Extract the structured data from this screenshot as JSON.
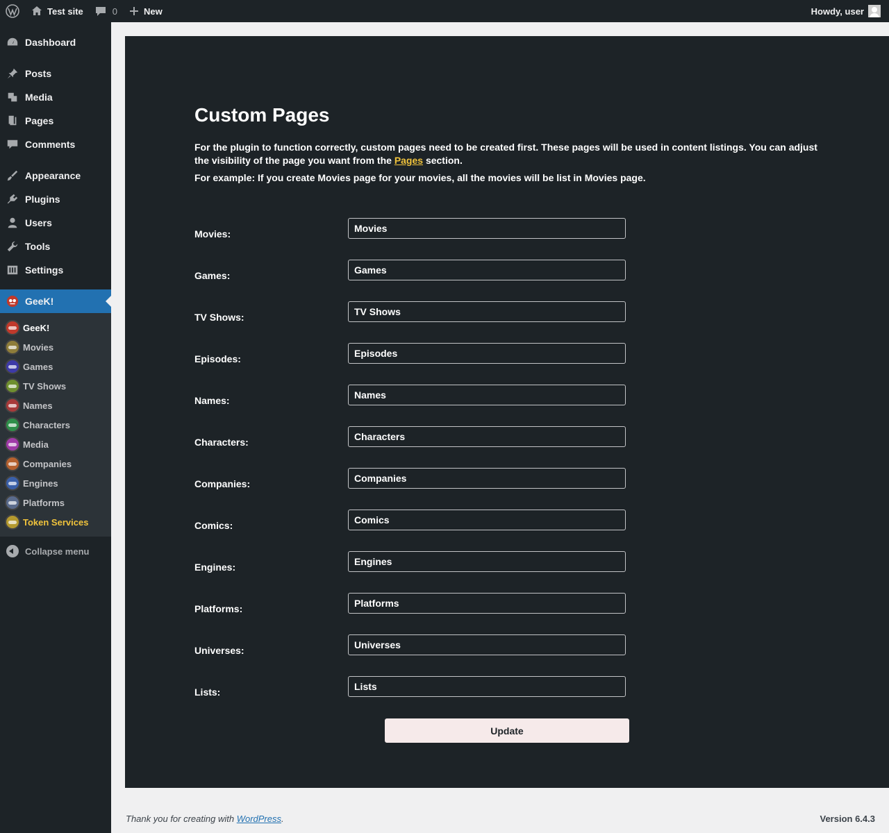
{
  "adminbar": {
    "site_name": "Test site",
    "comments_count": "0",
    "new_label": "New",
    "howdy": "Howdy, user"
  },
  "sidebar": {
    "items": [
      {
        "label": "Dashboard",
        "icon": "dashboard-icon"
      },
      {
        "label": "Posts",
        "icon": "pin-icon"
      },
      {
        "label": "Media",
        "icon": "media-icon"
      },
      {
        "label": "Pages",
        "icon": "pages-icon"
      },
      {
        "label": "Comments",
        "icon": "comment-icon"
      },
      {
        "label": "Appearance",
        "icon": "brush-icon"
      },
      {
        "label": "Plugins",
        "icon": "plug-icon"
      },
      {
        "label": "Users",
        "icon": "user-icon"
      },
      {
        "label": "Tools",
        "icon": "wrench-icon"
      },
      {
        "label": "Settings",
        "icon": "sliders-icon"
      },
      {
        "label": "GeeK!",
        "icon": "geek-avatar-icon"
      }
    ],
    "submenu": [
      {
        "label": "GeeK!",
        "color": "#c0392b"
      },
      {
        "label": "Movies",
        "color": "#8e7d3a"
      },
      {
        "label": "Games",
        "color": "#3d3aa8"
      },
      {
        "label": "TV Shows",
        "color": "#6f8f2f"
      },
      {
        "label": "Names",
        "color": "#a83a3a"
      },
      {
        "label": "Characters",
        "color": "#2f8f4a"
      },
      {
        "label": "Media",
        "color": "#a03aa8"
      },
      {
        "label": "Companies",
        "color": "#b5612f"
      },
      {
        "label": "Engines",
        "color": "#3a5fa8"
      },
      {
        "label": "Platforms",
        "color": "#5a6b8c"
      },
      {
        "label": "Token Services",
        "color": "#b59a2f"
      }
    ],
    "collapse_label": "Collapse menu"
  },
  "main": {
    "title": "Custom Pages",
    "desc_part1": "For the plugin to function correctly, custom pages need to be created first. These pages will be used in content listings. You can adjust the visibility of the page you want from the ",
    "desc_link": "Pages",
    "desc_part2": " section.",
    "example": "For example: If you create Movies page for your movies, all the movies will be list in Movies page.",
    "fields": [
      {
        "label": "Movies:",
        "value": "Movies"
      },
      {
        "label": "Games:",
        "value": "Games"
      },
      {
        "label": "TV Shows:",
        "value": "TV Shows"
      },
      {
        "label": "Episodes:",
        "value": "Episodes"
      },
      {
        "label": "Names:",
        "value": "Names"
      },
      {
        "label": "Characters:",
        "value": "Characters"
      },
      {
        "label": "Companies:",
        "value": "Companies"
      },
      {
        "label": "Comics:",
        "value": "Comics"
      },
      {
        "label": "Engines:",
        "value": "Engines"
      },
      {
        "label": "Platforms:",
        "value": "Platforms"
      },
      {
        "label": "Universes:",
        "value": "Universes"
      },
      {
        "label": "Lists:",
        "value": "Lists"
      }
    ],
    "update_label": "Update"
  },
  "footer": {
    "thanks": "Thank you for creating with ",
    "link": "WordPress",
    "period": ".",
    "version": "Version 6.4.3"
  }
}
